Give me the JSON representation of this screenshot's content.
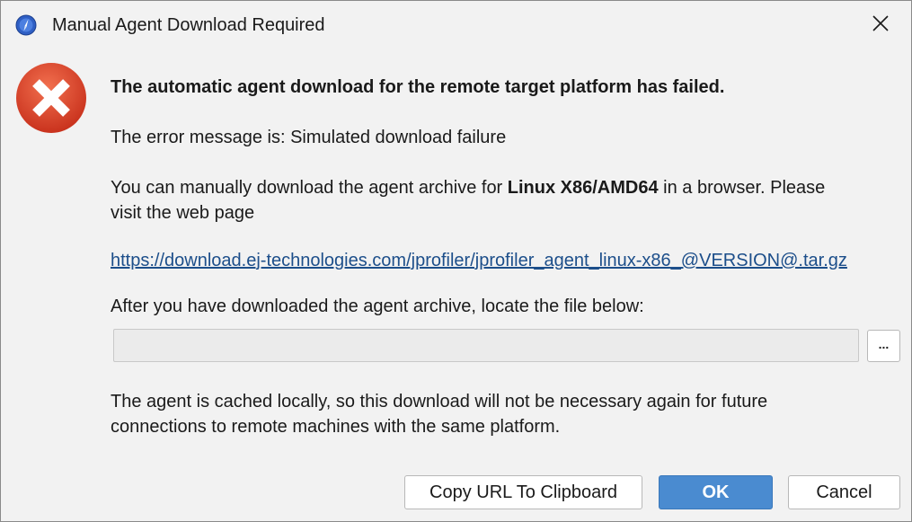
{
  "window": {
    "title": "Manual Agent Download Required",
    "app_icon": "jprofiler-compass-icon",
    "close_icon": "close-icon"
  },
  "message": {
    "icon": "error-icon",
    "headline": "The automatic agent download for the remote target platform has failed.",
    "error_text": "The error message is: Simulated download failure",
    "manual_prefix": "You can manually download the agent archive for ",
    "platform": "Linux X86/AMD64",
    "manual_suffix": " in a browser. Please",
    "manual_line2": "visit the web page",
    "url": "https://download.ej-technologies.com/jprofiler/jprofiler_agent_linux-x86_@VERSION@.tar.gz",
    "locate_label": "After you have downloaded the agent archive, locate the file below:",
    "file_value": "",
    "browse_label": "...",
    "cache_line1": "The agent is cached locally, so this download will not be necessary again for future",
    "cache_line2": "connections to remote machines with the same platform."
  },
  "buttons": {
    "copy_url": "Copy URL To Clipboard",
    "ok": "OK",
    "cancel": "Cancel"
  },
  "colors": {
    "ok_button": "#4a8bd0",
    "link": "#1c4e8a",
    "error_red": "#e0412a"
  }
}
